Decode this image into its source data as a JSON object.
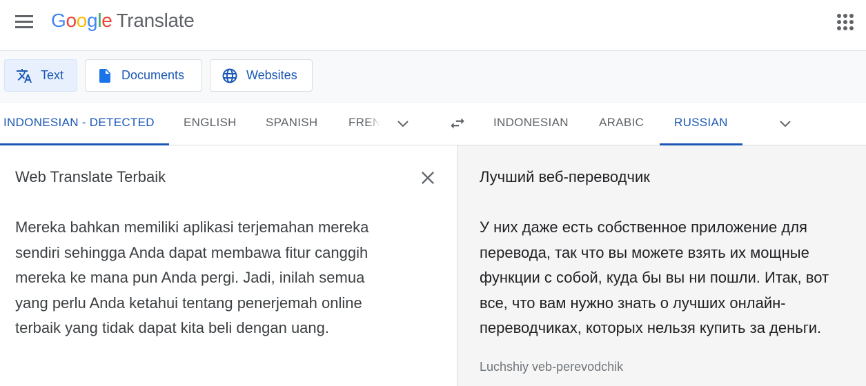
{
  "header": {
    "logo_letters": [
      "G",
      "o",
      "o",
      "g",
      "l",
      "e"
    ],
    "product_name": "Translate",
    "menu_icon": "hamburger-menu-icon",
    "apps_icon": "google-apps-grid-icon"
  },
  "modes": [
    {
      "label": "Text",
      "icon": "translate-icon",
      "active": true
    },
    {
      "label": "Documents",
      "icon": "document-icon",
      "active": false
    },
    {
      "label": "Websites",
      "icon": "globe-icon",
      "active": false
    }
  ],
  "source_languages": [
    {
      "label": "INDONESIAN - DETECTED",
      "active": true
    },
    {
      "label": "ENGLISH",
      "active": false
    },
    {
      "label": "SPANISH",
      "active": false
    },
    {
      "label": "FREN",
      "active": false
    }
  ],
  "target_languages": [
    {
      "label": "INDONESIAN",
      "active": false
    },
    {
      "label": "ARABIC",
      "active": false
    },
    {
      "label": "RUSSIAN",
      "active": true
    }
  ],
  "source": {
    "text": "Web Translate Terbaik\n\nMereka bahkan memiliki aplikasi terjemahan mereka\nsendiri sehingga Anda dapat membawa fitur canggih\nmereka ke mana pun Anda pergi. Jadi, inilah semua\nyang perlu Anda ketahui tentang penerjemah online\nterbaik yang tidak dapat kita beli dengan uang."
  },
  "target": {
    "text": "Лучший веб-переводчик\n\nУ них даже есть собственное приложение для\nперевода, так что вы можете взять их мощные\nфункции с собой, куда бы вы ни пошли. Итак, вот\nвсе, что вам нужно знать о лучших онлайн-\nпереводчиках, которых нельзя купить за деньги.",
    "romanization": "Luchshiy veb-perevodchik"
  },
  "colors": {
    "accent": "#1a57b5",
    "target_bg": "#f5f5f5"
  }
}
